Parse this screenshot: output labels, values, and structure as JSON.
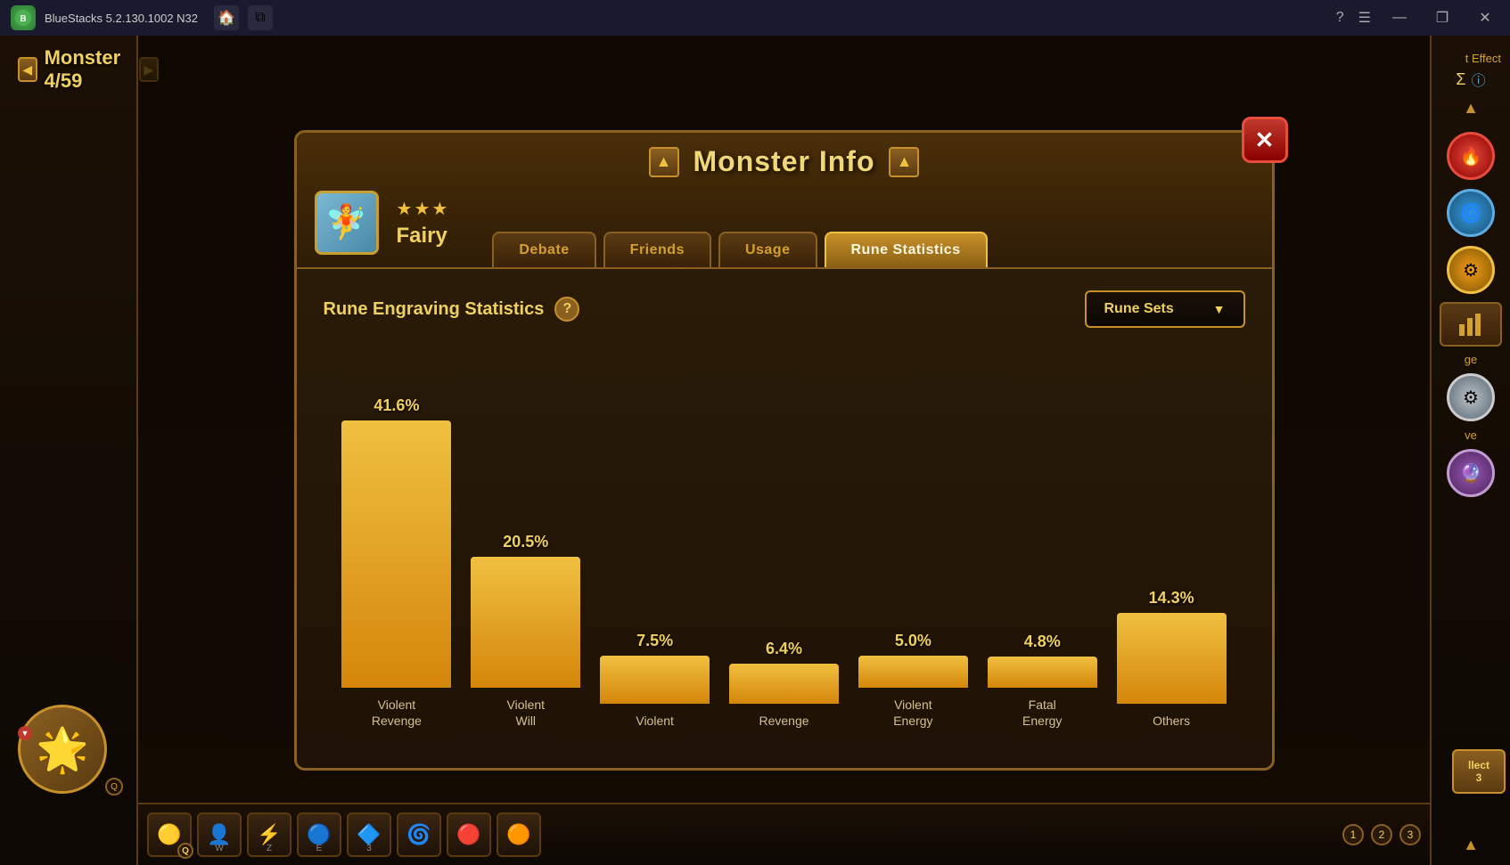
{
  "app": {
    "name": "BlueStacks",
    "version": "5.2.130.1002 N32",
    "title": "BlueStacks 5.2.130.1002 N32"
  },
  "titlebar": {
    "home_icon": "🏠",
    "duplicate_icon": "⧉",
    "help_icon": "?",
    "menu_icon": "☰",
    "minimize_icon": "—",
    "restore_icon": "❐",
    "close_icon": "✕"
  },
  "monster_counter": {
    "label": "Monster 4/59",
    "nav_prev": "◀",
    "nav_next": "▶"
  },
  "modal": {
    "title": "Monster Info",
    "nav_prev": "▲",
    "nav_next": "▲",
    "close_label": "✕",
    "monster": {
      "name": "Fairy",
      "stars": 3,
      "element": "fairy"
    },
    "tabs": [
      {
        "id": "debate",
        "label": "Debate",
        "active": false
      },
      {
        "id": "friends",
        "label": "Friends",
        "active": false
      },
      {
        "id": "usage",
        "label": "Usage",
        "active": false
      },
      {
        "id": "rune-statistics",
        "label": "Rune Statistics",
        "active": true
      }
    ]
  },
  "rune_statistics": {
    "section_title": "Rune Engraving Statistics",
    "help_icon": "?",
    "dropdown_label": "Rune Sets",
    "dropdown_arrow": "▼",
    "chart": {
      "bars": [
        {
          "label": "Violent\nRevenge",
          "label_line1": "Violent",
          "label_line2": "Revenge",
          "percentage": "41.6%",
          "value": 41.6,
          "height_pct": 100
        },
        {
          "label": "Violent\nWill",
          "label_line1": "Violent",
          "label_line2": "Will",
          "percentage": "20.5%",
          "value": 20.5,
          "height_pct": 49
        },
        {
          "label": "Violent",
          "label_line1": "Violent",
          "label_line2": "",
          "percentage": "7.5%",
          "value": 7.5,
          "height_pct": 18
        },
        {
          "label": "Revenge",
          "label_line1": "Revenge",
          "label_line2": "",
          "percentage": "6.4%",
          "value": 6.4,
          "height_pct": 15
        },
        {
          "label": "Violent\nEnergy",
          "label_line1": "Violent",
          "label_line2": "Energy",
          "percentage": "5.0%",
          "value": 5.0,
          "height_pct": 12
        },
        {
          "label": "Fatal\nEnergy",
          "label_line1": "Fatal",
          "label_line2": "Energy",
          "percentage": "4.8%",
          "value": 4.8,
          "height_pct": 11.5
        },
        {
          "label": "Others",
          "label_line1": "Others",
          "label_line2": "",
          "percentage": "14.3%",
          "value": 14.3,
          "height_pct": 34
        }
      ]
    }
  },
  "right_sidebar": {
    "effect_label": "t Effect",
    "sigma_icon": "Σ",
    "info_icon": "ⓘ",
    "scroll_up": "▲",
    "scroll_down": "▼",
    "collect_label": "llect",
    "collect_number": "3"
  },
  "taskbar": {
    "items": [
      {
        "icon": "🟡",
        "badge": "Q"
      },
      {
        "icon": "👤",
        "badge": "W"
      },
      {
        "icon": "⚡",
        "badge": "Z"
      },
      {
        "icon": "🔵",
        "badge": "E"
      },
      {
        "icon": "🔷",
        "badge": "3"
      },
      {
        "icon": "🌀",
        "badge": ""
      },
      {
        "icon": "🔴",
        "badge": ""
      },
      {
        "icon": "🟠",
        "badge": ""
      }
    ],
    "page_indicators": [
      {
        "label": "1",
        "active": false
      },
      {
        "label": "2",
        "active": false
      },
      {
        "label": "3",
        "active": false
      }
    ]
  }
}
